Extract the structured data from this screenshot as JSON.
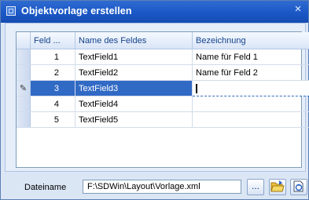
{
  "window": {
    "title": "Objektvorlage erstellen",
    "close": "×"
  },
  "grid": {
    "columns": [
      "Feld ...",
      "Name des Feldes",
      "Bezeichnung"
    ],
    "rows": [
      {
        "nr": "1",
        "name": "TextField1",
        "bez": "Name für Feld 1"
      },
      {
        "nr": "2",
        "name": "TextField2",
        "bez": "Name für Feld 2"
      },
      {
        "nr": "3",
        "name": "TextField3",
        "bez": ""
      },
      {
        "nr": "4",
        "name": "TextField4",
        "bez": ""
      },
      {
        "nr": "5",
        "name": "TextField5",
        "bez": ""
      }
    ],
    "selected_row": 3,
    "edit_indicator_icon": "pencil-icon"
  },
  "footer": {
    "label": "Dateiname",
    "path": "F:\\SDWin\\Layout\\Vorlage.xml",
    "browse_label": "...",
    "icons": [
      "open-folder-icon",
      "new-file-icon"
    ]
  },
  "colors": {
    "titlebar": "#1b58c6",
    "selection": "#316ac5",
    "header_text": "#15428b"
  }
}
